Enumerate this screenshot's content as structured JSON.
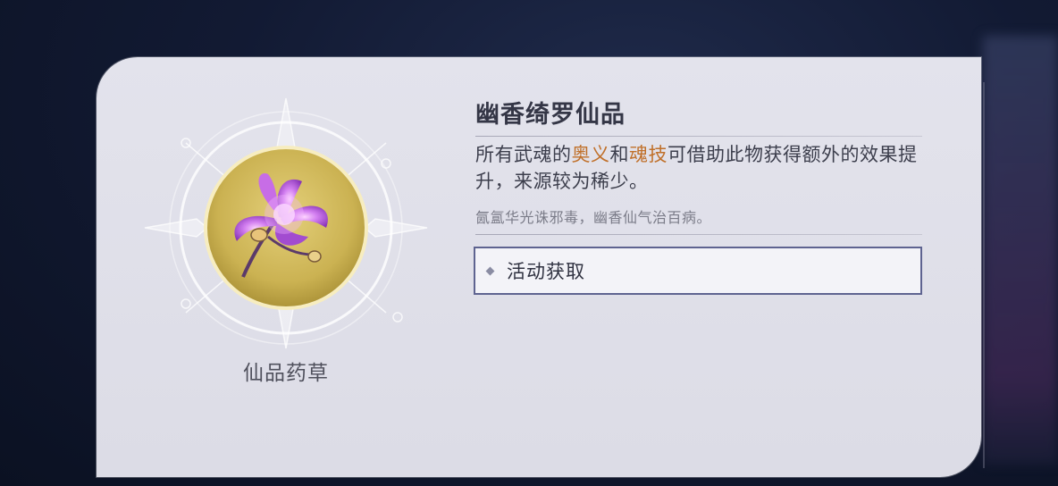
{
  "item": {
    "name": "仙品药草",
    "title": "幽香绮罗仙品",
    "description": {
      "p1": "所有武魂的",
      "hl1": "奥义",
      "p2": "和",
      "hl2": "魂技",
      "p3": "可借助此物获得额外的效果提升，来源较为稀少。"
    },
    "flavor": "氤氲华光诛邪毒，幽香仙气治百病。",
    "source": {
      "label": "活动获取"
    }
  },
  "colors": {
    "highlight": "#c0702a",
    "button_border": "#5e6390",
    "card_bg": "#e0e0ea",
    "medallion_gold": "#c9b04e",
    "flower_purple": "#b25ad6"
  },
  "icons": {
    "item_icon": "purple-lotus-flower-icon",
    "source_bullet": "diamond-icon"
  }
}
